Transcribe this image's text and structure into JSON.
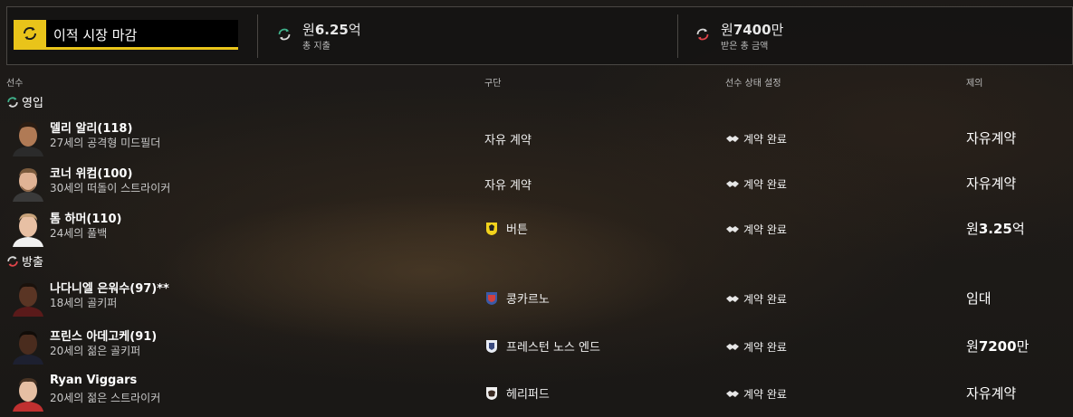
{
  "header": {
    "search_title": "이적 시장 마감",
    "spent": {
      "prefix": "원",
      "amount": "6.25",
      "suffix": "억",
      "label": "총 지출"
    },
    "received": {
      "prefix": "원",
      "amount": "7400",
      "suffix": "만",
      "label": "받은 총 금액"
    }
  },
  "columns": {
    "player": "선수",
    "club": "구단",
    "status": "선수 상태 설정",
    "offer": "제의"
  },
  "sections": {
    "in": "영입",
    "out": "방출"
  },
  "rows": [
    {
      "name": "델리 알리",
      "rating": "(118)",
      "desc": "27세의 공격형 미드필더",
      "club": "자유 계약",
      "status": "계약 완료",
      "offer": "자유계약"
    },
    {
      "name": "코너 위컴",
      "rating": "(100)",
      "desc": "30세의 떠돌이 스트라이커",
      "club": "자유 계약",
      "status": "계약 완료",
      "offer": "자유계약"
    },
    {
      "name": "톰 하머",
      "rating": "(110)",
      "desc": "24세의 풀백",
      "club": "버튼",
      "status": "계약 완료",
      "offer_prefix": "원",
      "offer_amount": "3.25",
      "offer_suffix": "억"
    },
    {
      "name": "나다니엘 은워수",
      "rating": "(97)**",
      "desc": "18세의 골키퍼",
      "club": "콩카르노",
      "status": "계약 완료",
      "offer": "임대"
    },
    {
      "name": "프린스 아데고케",
      "rating": "(91)",
      "desc": "20세의 젊은 골키퍼",
      "club": "프레스턴 노스 엔드",
      "status": "계약 완료",
      "offer_prefix": "원",
      "offer_amount": "7200",
      "offer_suffix": "만"
    },
    {
      "name": "Ryan Viggars",
      "rating": "",
      "desc": "20세의 젊은 스트라이커",
      "club": "헤리퍼드",
      "status": "계약 완료",
      "offer": "자유계약"
    }
  ],
  "colors": {
    "accent": "#e9c41a",
    "in_icon": "#3fb08a",
    "out_icon": "#e0444a"
  }
}
